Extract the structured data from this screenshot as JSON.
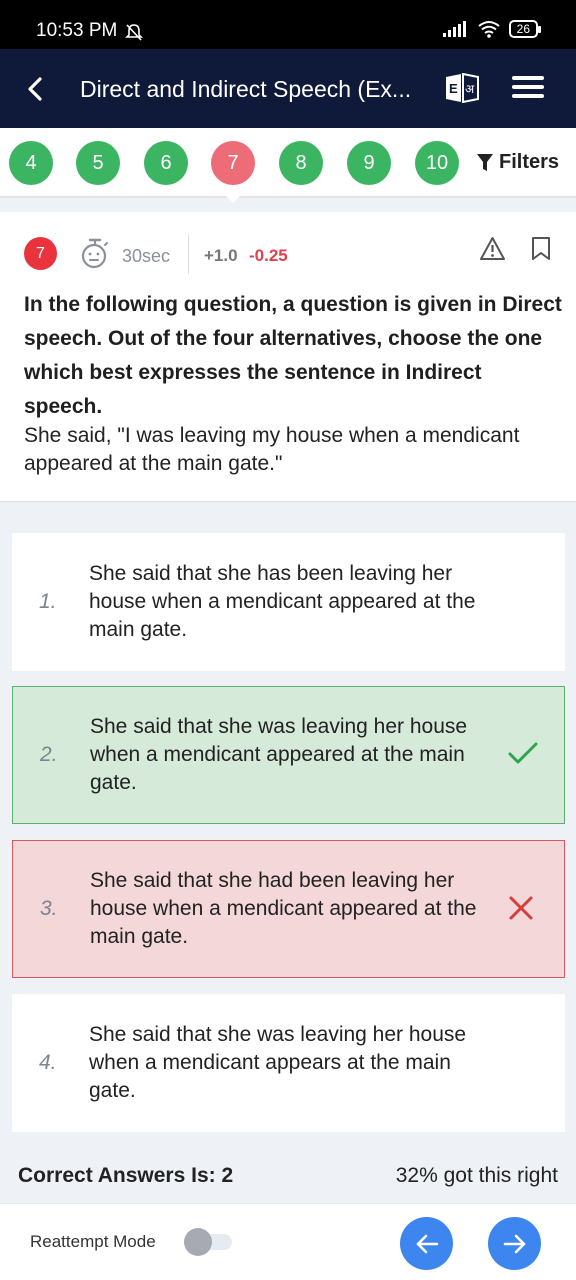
{
  "status_bar": {
    "time": "10:53 PM",
    "battery": "26"
  },
  "app_bar": {
    "title": "Direct and Indirect Speech (Ex...",
    "lang_icon_text_1": "E",
    "lang_icon_text_2": "अ"
  },
  "question_nav": {
    "numbers": [
      "4",
      "5",
      "6",
      "7",
      "8",
      "9",
      "10"
    ],
    "active": "7",
    "filters_label": "Filters"
  },
  "question": {
    "number": "7",
    "timer": "30sec",
    "positive_mark": "+1.0",
    "negative_mark": "-0.25",
    "instruction": "In the following question, a question is given in Direct speech. Out of the four alternatives, choose the one which best expresses the sentence in Indirect speech.",
    "sentence": "She said, \"I was leaving my house when a mendicant appeared at the main gate.\""
  },
  "options": [
    {
      "num": "1.",
      "text": "She said that she has been leaving her house when a mendicant appeared at the main gate.",
      "state": "normal"
    },
    {
      "num": "2.",
      "text": "She said that she was leaving her house when a mendicant appeared at the main gate.",
      "state": "correct"
    },
    {
      "num": "3.",
      "text": "She said that she had been leaving her house when a mendicant appeared at the main gate.",
      "state": "wrong"
    },
    {
      "num": "4.",
      "text": "She said that she was leaving her house when a mendicant appears at the main gate.",
      "state": "normal"
    }
  ],
  "result": {
    "correct_answer": "Correct Answers Is: 2",
    "stat": "32% got this right"
  },
  "bottom_bar": {
    "reattempt_label": "Reattempt Mode",
    "reattempt_on": false
  },
  "colors": {
    "header": "#0f1a3b",
    "bubble_green": "#3cb563",
    "bubble_active": "#ee6c78",
    "correct": "#d5ead9",
    "wrong": "#f3d7d9",
    "nav_button": "#3d86ef"
  }
}
